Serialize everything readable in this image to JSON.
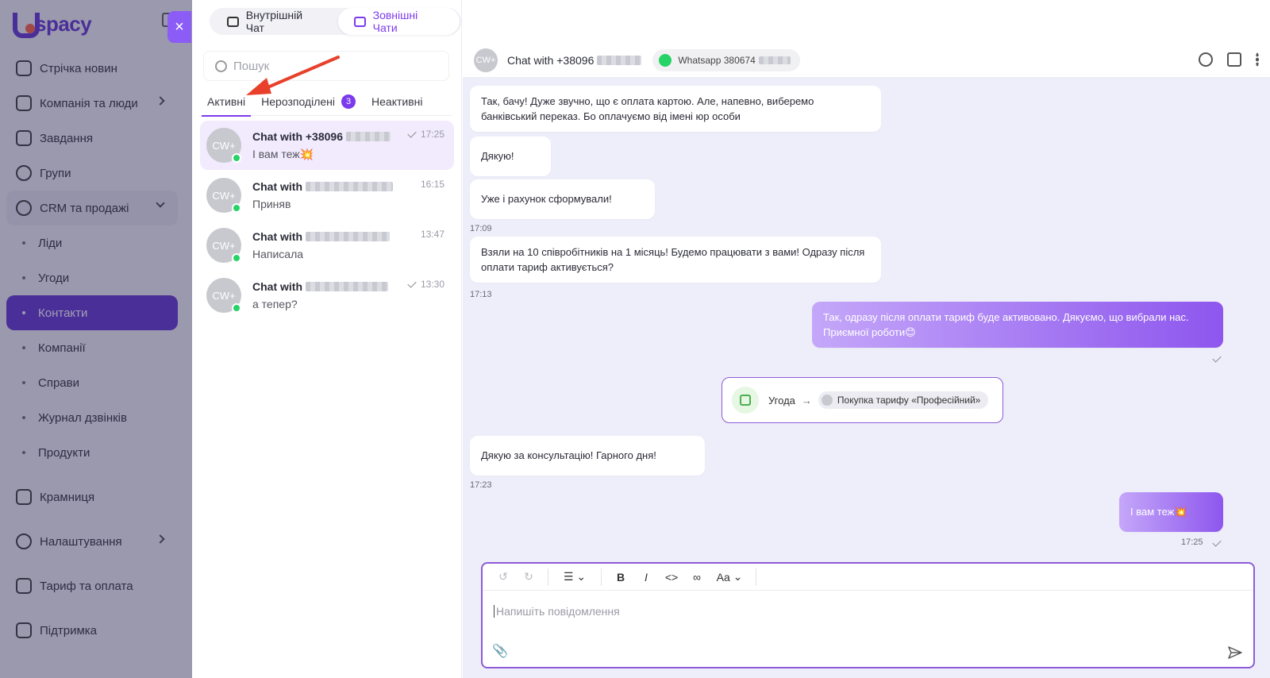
{
  "logo": {
    "text": "spacy"
  },
  "nav": {
    "items": [
      {
        "label": "Стрічка новин",
        "icon": "home-icon"
      },
      {
        "label": "Компанія та люди",
        "icon": "building-icon",
        "has_children": true
      },
      {
        "label": "Завдання",
        "icon": "calendar-icon"
      },
      {
        "label": "Групи",
        "icon": "users-icon"
      },
      {
        "label": "CRM та продажі",
        "icon": "database-icon",
        "expanded": true
      },
      {
        "label": "Ліди",
        "sub": true
      },
      {
        "label": "Угоди",
        "sub": true
      },
      {
        "label": "Контакти",
        "sub": true,
        "active": true
      },
      {
        "label": "Компанії",
        "sub": true
      },
      {
        "label": "Справи",
        "sub": true
      },
      {
        "label": "Журнал дзвінків",
        "sub": true
      },
      {
        "label": "Продукти",
        "sub": true
      },
      {
        "label": "Крамниця",
        "icon": "store-icon"
      },
      {
        "label": "Налаштування",
        "icon": "gear-icon",
        "has_children": true
      },
      {
        "label": "Тариф та оплата",
        "icon": "wallet-icon"
      },
      {
        "label": "Підтримка",
        "icon": "help-icon"
      }
    ]
  },
  "close_label": "×",
  "top_tabs": [
    {
      "label": "Внутрішній Чат",
      "active": false
    },
    {
      "label": "Зовнішні Чати",
      "active": true
    }
  ],
  "search": {
    "placeholder": "Пошук"
  },
  "sub_tabs": [
    {
      "label": "Активні",
      "active": true
    },
    {
      "label": "Нерозподілені",
      "badge": "3"
    },
    {
      "label": "Неактивні"
    }
  ],
  "chats": [
    {
      "avatar": "CW+",
      "name": "Chat with +38096",
      "preview": "І вам теж💥",
      "time": "17:25",
      "read": true,
      "active": true
    },
    {
      "avatar": "CW+",
      "name": "Chat with",
      "preview": "Приняв",
      "time": "16:15",
      "read": false
    },
    {
      "avatar": "CW+",
      "name": "Chat with",
      "preview": "Написала",
      "time": "13:47",
      "read": false
    },
    {
      "avatar": "CW+",
      "name": "Chat with",
      "preview": "а тепер?",
      "time": "13:30",
      "read": true
    }
  ],
  "conversation": {
    "avatar": "CW+",
    "title": "Chat with +38096",
    "channel": "Whatsapp 380674",
    "messages": [
      {
        "text": "Так, бачу! Дуже звучно, що є оплата картою. Але, напевно, виберемо банківський переказ. Бо оплачуємо від імені юр особи"
      },
      {
        "text": "Дякую!"
      },
      {
        "text": "Уже і рахунок сформували!",
        "time": "17:09"
      },
      {
        "text": "Взяли на 10 співробітників на 1 місяць! Будемо працювати з вами! Одразу після оплати тариф активується?",
        "time": "17:13"
      },
      {
        "text": "Так, одразу після оплати тариф буде активовано. Дякуємо, що вибрали нас. Приємної роботи😊"
      },
      {
        "text": "Дякую за консультацію! Гарного дня!",
        "time": "17:23"
      },
      {
        "text": "І вам теж💥",
        "time": "17:25"
      }
    ],
    "deal": {
      "label": "Угода",
      "arrow": "→",
      "name": "Покупка тарифу «Професійний»"
    }
  },
  "composer": {
    "placeholder": "Напишіть повідомлення",
    "toolbar": {
      "bold": "B",
      "italic": "I",
      "code": "<>",
      "font": "Aa"
    }
  }
}
